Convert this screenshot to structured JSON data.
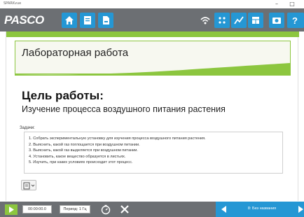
{
  "window": {
    "title": "SPARKvue",
    "minimize": "–",
    "maximize": "□"
  },
  "toolbar": {
    "logo": "PASCO",
    "left_buttons": [
      "home-icon",
      "journal-icon",
      "page-icon"
    ],
    "right_buttons": [
      "wireless-icon",
      "sensor-icon",
      "graph-icon",
      "table-icon",
      "camera-icon",
      "help-icon"
    ],
    "accent_color": "#2597d4",
    "bar_color": "#6c6f73"
  },
  "page": {
    "header_title": "Лабораторная работа",
    "goal_title": "Цель работы:",
    "goal_text": "Изучение процесса воздушного питания растения",
    "tasks_label": "Задачи:",
    "tasks": [
      "1. Собрать экспериментальную установку для изучения процесса воздушного питания растения.",
      "2. Выяснить, какой газ поглощается при воздушном питании.",
      "3. Выяснить, какой газ выделяется при воздушном питании.",
      "4. Установить, какое вещество образуется в листьях.",
      "5. Изучить, при каких условиях происходит этот процесс."
    ],
    "accent_color": "#8cc63f"
  },
  "bottombar": {
    "time": "00:00:00.0",
    "period": "Период: 1 Гц",
    "page_indicator": "8: Без названия",
    "play_color": "#8cc63f"
  }
}
